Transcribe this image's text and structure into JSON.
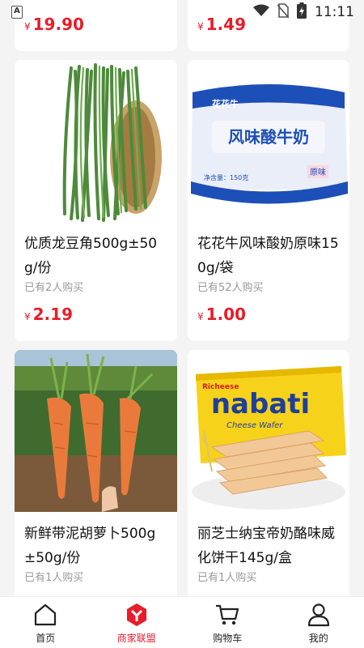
{
  "status_bar": {
    "time": "11:11",
    "left_badge": "A"
  },
  "top_row": [
    {
      "price_symbol": "¥",
      "price": "19.90"
    },
    {
      "price_symbol": "¥",
      "price": "1.49"
    }
  ],
  "products": [
    {
      "title": "优质龙豆角500g±50g/份",
      "sold": "已有2人购买",
      "price_symbol": "¥",
      "price": "2.19",
      "image": "green-beans-image"
    },
    {
      "title": "花花牛风味酸奶原味150g/袋",
      "sold": "已有52人购买",
      "price_symbol": "¥",
      "price": "1.00",
      "image": "yogurt-image"
    },
    {
      "title": "新鲜带泥胡萝卜500g±50g/份",
      "sold": "已有1人购买",
      "image": "carrot-image"
    },
    {
      "title": "丽芝士纳宝帝奶酪味威化饼干145g/盒",
      "sold": "已有1人购买",
      "image": "wafer-image"
    }
  ],
  "yogurt_package": {
    "brand": "花花牛",
    "name": "风味酸牛奶",
    "tag": "原味",
    "net": "净含量：150克"
  },
  "wafer_package": {
    "brand": "nabati",
    "sub": "Richeese",
    "tagline": "Cheese Wafer"
  },
  "bottom_nav": [
    {
      "label": "首页",
      "icon": "home-icon",
      "active": false
    },
    {
      "label": "商家联盟",
      "icon": "merchant-alliance-icon",
      "active": true
    },
    {
      "label": "购物车",
      "icon": "cart-icon",
      "active": false
    },
    {
      "label": "我的",
      "icon": "profile-icon",
      "active": false
    }
  ],
  "colors": {
    "accent": "#e81c2a",
    "background": "#f4f4f4",
    "muted_text": "#999999"
  }
}
